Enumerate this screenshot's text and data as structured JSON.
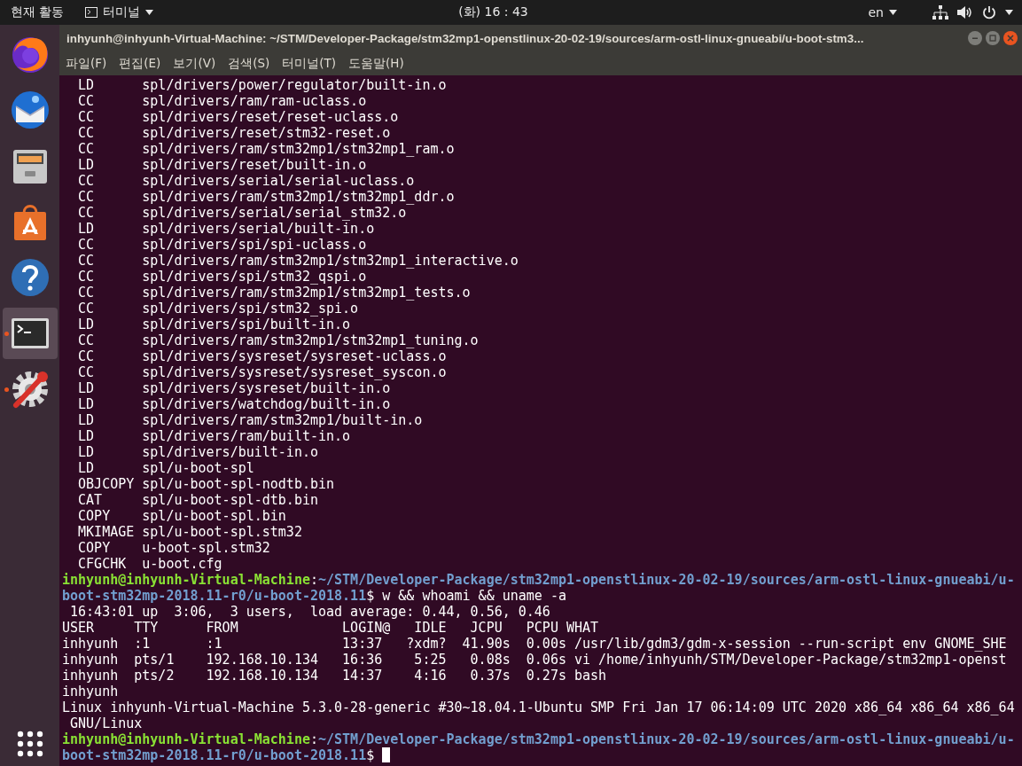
{
  "top_bar": {
    "activities": "현재 활동",
    "app_menu": "터미널",
    "clock": "(화) 16 : 43",
    "language": "en"
  },
  "dock": {
    "items": [
      {
        "kind": "firefox",
        "running": false,
        "selected": false
      },
      {
        "kind": "thunderbird",
        "running": false,
        "selected": false
      },
      {
        "kind": "files",
        "running": false,
        "selected": false
      },
      {
        "kind": "store",
        "running": false,
        "selected": false
      },
      {
        "kind": "help",
        "running": false,
        "selected": false
      },
      {
        "kind": "terminal",
        "running": true,
        "selected": true
      },
      {
        "kind": "settings",
        "running": true,
        "selected": false
      }
    ]
  },
  "window": {
    "title": "inhyunh@inhyunh-Virtual-Machine: ~/STM/Developer-Package/stm32mp1-openstlinux-20-02-19/sources/arm-ostl-linux-gnueabi/u-boot-stm3...",
    "menu": [
      "파일(F)",
      "편집(E)",
      "보기(V)",
      "검색(S)",
      "터미널(T)",
      "도움말(H)"
    ]
  },
  "terminal": {
    "lines": [
      {
        "kind": "output",
        "text": "  LD      spl/drivers/power/regulator/built-in.o"
      },
      {
        "kind": "output",
        "text": "  CC      spl/drivers/ram/ram-uclass.o"
      },
      {
        "kind": "output",
        "text": "  CC      spl/drivers/reset/reset-uclass.o"
      },
      {
        "kind": "output",
        "text": "  CC      spl/drivers/reset/stm32-reset.o"
      },
      {
        "kind": "output",
        "text": "  CC      spl/drivers/ram/stm32mp1/stm32mp1_ram.o"
      },
      {
        "kind": "output",
        "text": "  LD      spl/drivers/reset/built-in.o"
      },
      {
        "kind": "output",
        "text": "  CC      spl/drivers/serial/serial-uclass.o"
      },
      {
        "kind": "output",
        "text": "  CC      spl/drivers/ram/stm32mp1/stm32mp1_ddr.o"
      },
      {
        "kind": "output",
        "text": "  CC      spl/drivers/serial/serial_stm32.o"
      },
      {
        "kind": "output",
        "text": "  LD      spl/drivers/serial/built-in.o"
      },
      {
        "kind": "output",
        "text": "  CC      spl/drivers/spi/spi-uclass.o"
      },
      {
        "kind": "output",
        "text": "  CC      spl/drivers/ram/stm32mp1/stm32mp1_interactive.o"
      },
      {
        "kind": "output",
        "text": "  CC      spl/drivers/spi/stm32_qspi.o"
      },
      {
        "kind": "output",
        "text": "  CC      spl/drivers/ram/stm32mp1/stm32mp1_tests.o"
      },
      {
        "kind": "output",
        "text": "  CC      spl/drivers/spi/stm32_spi.o"
      },
      {
        "kind": "output",
        "text": "  LD      spl/drivers/spi/built-in.o"
      },
      {
        "kind": "output",
        "text": "  CC      spl/drivers/ram/stm32mp1/stm32mp1_tuning.o"
      },
      {
        "kind": "output",
        "text": "  CC      spl/drivers/sysreset/sysreset-uclass.o"
      },
      {
        "kind": "output",
        "text": "  CC      spl/drivers/sysreset/sysreset_syscon.o"
      },
      {
        "kind": "output",
        "text": "  LD      spl/drivers/sysreset/built-in.o"
      },
      {
        "kind": "output",
        "text": "  LD      spl/drivers/watchdog/built-in.o"
      },
      {
        "kind": "output",
        "text": "  LD      spl/drivers/ram/stm32mp1/built-in.o"
      },
      {
        "kind": "output",
        "text": "  LD      spl/drivers/ram/built-in.o"
      },
      {
        "kind": "output",
        "text": "  LD      spl/drivers/built-in.o"
      },
      {
        "kind": "output",
        "text": "  LD      spl/u-boot-spl"
      },
      {
        "kind": "output",
        "text": "  OBJCOPY spl/u-boot-spl-nodtb.bin"
      },
      {
        "kind": "output",
        "text": "  CAT     spl/u-boot-spl-dtb.bin"
      },
      {
        "kind": "output",
        "text": "  COPY    spl/u-boot-spl.bin"
      },
      {
        "kind": "output",
        "text": "  MKIMAGE spl/u-boot-spl.stm32"
      },
      {
        "kind": "output",
        "text": "  COPY    u-boot-spl.stm32"
      },
      {
        "kind": "output",
        "text": "  CFGCHK  u-boot.cfg"
      },
      {
        "kind": "prompt",
        "user_host": "inhyunh@inhyunh-Virtual-Machine",
        "separator": ":",
        "path": "~/STM/Developer-Package/stm32mp1-openstlinux-20-02-19/sources/arm-ostl-linux-gnueabi/u-boot-stm32mp-2018.11-r0/u-boot-2018.11",
        "suffix": "$ w && whoami && uname -a",
        "cursor": false
      },
      {
        "kind": "output",
        "text": " 16:43:01 up  3:06,  3 users,  load average: 0.44, 0.56, 0.46"
      },
      {
        "kind": "output",
        "text": "USER     TTY      FROM             LOGIN@   IDLE   JCPU   PCPU WHAT"
      },
      {
        "kind": "output",
        "text": "inhyunh  :1       :1               13:37   ?xdm?  41.90s  0.00s /usr/lib/gdm3/gdm-x-session --run-script env GNOME_SHE"
      },
      {
        "kind": "output",
        "text": "inhyunh  pts/1    192.168.10.134   16:36    5:25   0.08s  0.06s vi /home/inhyunh/STM/Developer-Package/stm32mp1-openst"
      },
      {
        "kind": "output",
        "text": "inhyunh  pts/2    192.168.10.134   14:37    4:16   0.37s  0.27s bash"
      },
      {
        "kind": "output",
        "text": "inhyunh"
      },
      {
        "kind": "output",
        "text": "Linux inhyunh-Virtual-Machine 5.3.0-28-generic #30~18.04.1-Ubuntu SMP Fri Jan 17 06:14:09 UTC 2020 x86_64 x86_64 x86_64"
      },
      {
        "kind": "output",
        "text": " GNU/Linux"
      },
      {
        "kind": "prompt",
        "user_host": "inhyunh@inhyunh-Virtual-Machine",
        "separator": ":",
        "path": "~/STM/Developer-Package/stm32mp1-openstlinux-20-02-19/sources/arm-ostl-linux-gnueabi/u-boot-stm32mp-2018.11-r0/u-boot-2018.11",
        "suffix": "$",
        "cursor": true
      }
    ]
  }
}
